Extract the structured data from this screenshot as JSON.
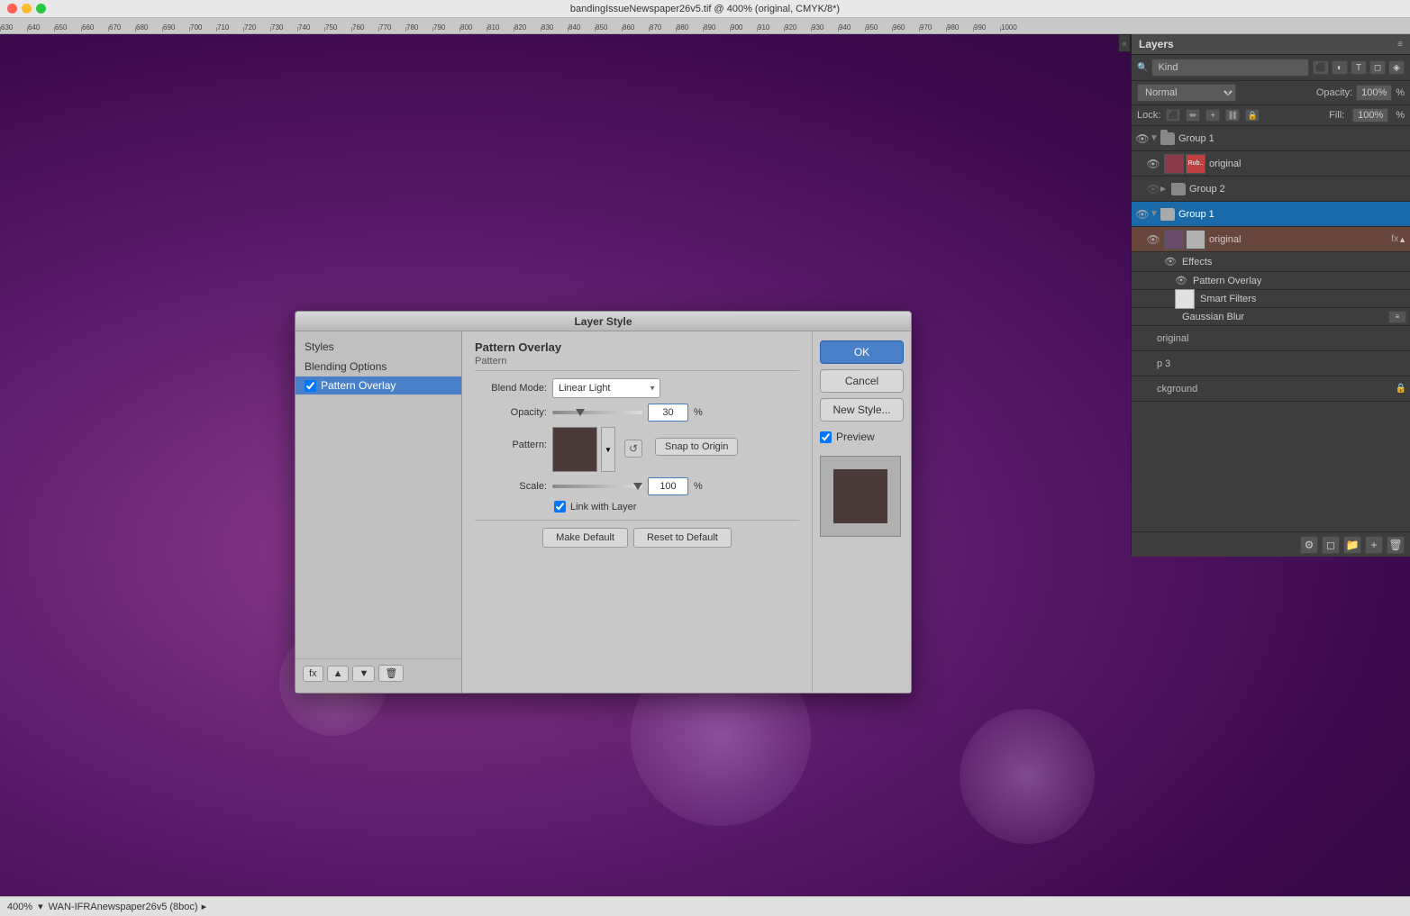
{
  "window": {
    "title": "bandingIssueNewspaper26v5.tif @ 400% (original, CMYK/8*)",
    "zoom": "400%",
    "filename": "WAN-IFRAnewspaper26v5 (8boc)"
  },
  "ruler": {
    "ticks": [
      "630",
      "640",
      "650",
      "660",
      "670",
      "680",
      "690",
      "700",
      "710",
      "720",
      "730",
      "740",
      "750",
      "760",
      "770",
      "780",
      "790",
      "800",
      "810",
      "820",
      "830",
      "840",
      "850",
      "860",
      "870",
      "880",
      "890",
      "900",
      "910",
      "920",
      "930",
      "940",
      "950",
      "960",
      "970",
      "980",
      "990",
      "1000"
    ]
  },
  "layers_panel": {
    "title": "Layers",
    "search_placeholder": "Kind",
    "blend_mode": "Normal",
    "opacity_label": "Opacity:",
    "opacity_value": "100%",
    "fill_label": "Fill:",
    "fill_value": "100%",
    "lock_label": "Lock:",
    "items": [
      {
        "id": "group1-top",
        "type": "group",
        "name": "Group 1",
        "visible": true,
        "expanded": true,
        "indent": 0
      },
      {
        "id": "original-top",
        "type": "layer",
        "name": "original",
        "visible": true,
        "indent": 1,
        "has_fx": false
      },
      {
        "id": "group2",
        "type": "group",
        "name": "Group 2",
        "visible": false,
        "expanded": false,
        "indent": 1
      },
      {
        "id": "group1-mid",
        "type": "group",
        "name": "Group 1",
        "visible": true,
        "expanded": true,
        "indent": 0
      },
      {
        "id": "original-mid",
        "type": "layer",
        "name": "original",
        "visible": true,
        "indent": 1,
        "has_fx": true,
        "selected": true
      },
      {
        "id": "effects",
        "type": "effects-header",
        "name": "Effects",
        "indent": 2
      },
      {
        "id": "pattern-overlay-fx",
        "type": "fx-item",
        "name": "Pattern Overlay",
        "indent": 3
      },
      {
        "id": "smart-filters",
        "type": "smart-header",
        "name": "Smart Filters",
        "indent": 2
      },
      {
        "id": "gaussian-blur",
        "type": "smart-item",
        "name": "Gaussian Blur",
        "indent": 3
      }
    ],
    "extra_rows": [
      {
        "name": "original",
        "indent": 0
      },
      {
        "name": "p 3",
        "indent": 0
      },
      {
        "name": "ckground",
        "indent": 0
      }
    ]
  },
  "layer_style_dialog": {
    "title": "Layer Style",
    "sidebar": {
      "items": [
        {
          "label": "Styles",
          "active": false,
          "type": "item"
        },
        {
          "label": "Blending Options",
          "active": false,
          "type": "item"
        },
        {
          "label": "Pattern Overlay",
          "active": true,
          "type": "checkbox",
          "checked": true
        }
      ],
      "bottom_buttons": [
        "fx",
        "▲",
        "▼",
        "🗑"
      ]
    },
    "section_title": "Pattern Overlay",
    "subsection_title": "Pattern",
    "fields": {
      "blend_mode_label": "Blend Mode:",
      "blend_mode_value": "Linear Light",
      "opacity_label": "Opacity:",
      "opacity_value": "30",
      "opacity_unit": "%",
      "pattern_label": "Pattern:",
      "scale_label": "Scale:",
      "scale_value": "100",
      "scale_unit": "%",
      "link_with_layer_label": "Link with Layer",
      "link_with_layer_checked": true
    },
    "buttons": {
      "snap_to_origin": "Snap to Origin",
      "make_default": "Make Default",
      "reset_to_default": "Reset to Default",
      "ok": "OK",
      "cancel": "Cancel",
      "new_style": "New Style...",
      "preview_label": "Preview"
    },
    "preview_checked": true
  },
  "status_bar": {
    "zoom": "400%",
    "filename": "WAN-IFRAnewspaper26v5 (8boc)"
  },
  "icons": {
    "eye": "👁",
    "folder": "📁",
    "chevron_right": "▶",
    "chevron_down": "▼",
    "lock": "🔒",
    "chain": "⛓",
    "fx": "fx",
    "trash": "🗑",
    "collapse": "«"
  }
}
